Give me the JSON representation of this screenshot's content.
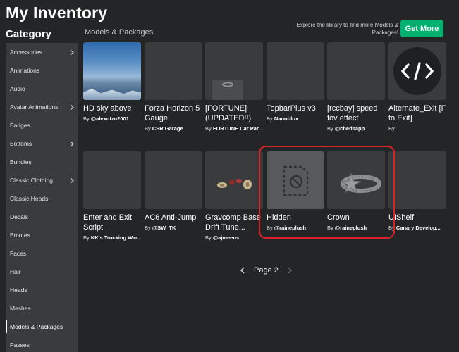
{
  "header": {
    "title": "My Inventory"
  },
  "sidebar": {
    "heading": "Category",
    "items": [
      {
        "label": "Accessories",
        "has_submenu": true
      },
      {
        "label": "Animations",
        "has_submenu": false
      },
      {
        "label": "Audio",
        "has_submenu": false
      },
      {
        "label": "Avatar Animations",
        "has_submenu": true
      },
      {
        "label": "Badges",
        "has_submenu": false
      },
      {
        "label": "Bottoms",
        "has_submenu": true
      },
      {
        "label": "Bundles",
        "has_submenu": false
      },
      {
        "label": "Classic Clothing",
        "has_submenu": true
      },
      {
        "label": "Classic Heads",
        "has_submenu": false
      },
      {
        "label": "Decals",
        "has_submenu": false
      },
      {
        "label": "Emotes",
        "has_submenu": false
      },
      {
        "label": "Faces",
        "has_submenu": false
      },
      {
        "label": "Hair",
        "has_submenu": false
      },
      {
        "label": "Heads",
        "has_submenu": false
      },
      {
        "label": "Meshes",
        "has_submenu": false
      },
      {
        "label": "Models & Packages",
        "has_submenu": false,
        "active": true
      },
      {
        "label": "Passes",
        "has_submenu": false
      }
    ]
  },
  "main": {
    "section_title": "Models & Packages",
    "promo_text": "Explore the library to find more Models & Packages!",
    "get_more_label": "Get More",
    "items": [
      {
        "name": "HD sky above",
        "by": "By",
        "creator": "@alexutzu2001",
        "thumb": "sky"
      },
      {
        "name": "Forza Horizon 5 Gauge",
        "by": "By",
        "creator": "CSR Garage",
        "thumb": "blank"
      },
      {
        "name": "[FORTUNE] (UPDATED!!) Gu...",
        "by": "By",
        "creator": "FORTUNE Car Par...",
        "thumb": "fortune"
      },
      {
        "name": "TopbarPlus v3",
        "by": "By",
        "creator": "Nanoblox",
        "thumb": "blank"
      },
      {
        "name": "[rccbay] speed fov effect",
        "by": "By",
        "creator": "@chedsapp",
        "thumb": "blank"
      },
      {
        "name": "Alternate_Exit [F to Exit]",
        "by": "By",
        "creator": "",
        "thumb": "code"
      },
      {
        "name": "Enter and Exit Script",
        "by": "By",
        "creator": "KK's Trucking War...",
        "thumb": "blank"
      },
      {
        "name": "AC6 Anti-Jump",
        "by": "By",
        "creator": "@SW_TK",
        "thumb": "blank"
      },
      {
        "name": "Gravcomp Base Drift Tune...",
        "by": "By",
        "creator": "@ajmeens",
        "thumb": "wheels"
      },
      {
        "name": "Hidden",
        "by": "By",
        "creator": "@raineplush",
        "thumb": "hidden"
      },
      {
        "name": "Crown",
        "by": "By",
        "creator": "@raineplush",
        "thumb": "crown"
      },
      {
        "name": "UIShelf",
        "by": "By",
        "creator": "Canary Develop...",
        "thumb": "blank"
      }
    ]
  },
  "pager": {
    "label": "Page 2"
  },
  "colors": {
    "background": "#232527",
    "card": "#393b3d",
    "accent": "#00b06f",
    "highlight": "#d8232a"
  },
  "icons": {
    "prev": "chevron-left-icon",
    "next": "chevron-right-icon",
    "submenu": "chevron-right-icon"
  }
}
